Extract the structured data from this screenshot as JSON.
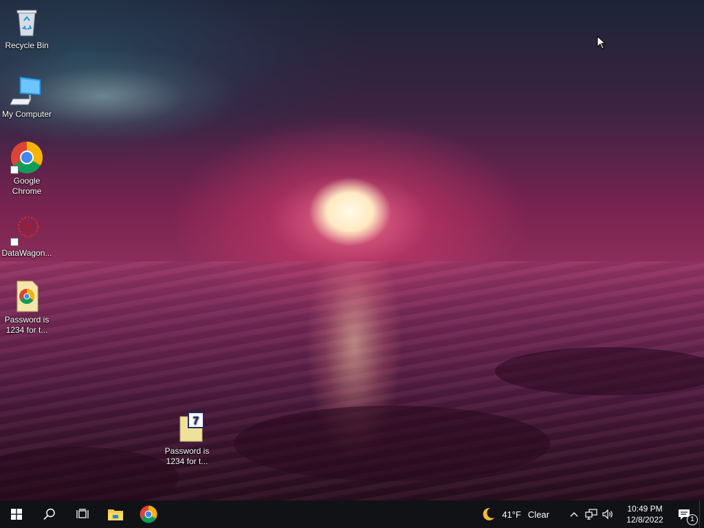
{
  "desktop": {
    "icons": [
      {
        "label": "Recycle Bin",
        "icon": "recycle-bin-icon"
      },
      {
        "label": "My Computer",
        "icon": "computer-monitor-icon"
      },
      {
        "label": "Google Chrome",
        "icon": "chrome-icon"
      },
      {
        "label": "DataWagon...",
        "icon": "datawagon-icon"
      },
      {
        "label": "Password is 1234 for t...",
        "icon": "chrome-document-icon"
      },
      {
        "label": "Password is 1234 for t...",
        "icon": "7zip-archive-icon"
      }
    ]
  },
  "taskbar": {
    "buttons": [
      {
        "name": "start",
        "icon": "windows-logo-icon"
      },
      {
        "name": "search",
        "icon": "search-icon"
      },
      {
        "name": "task-view",
        "icon": "task-view-icon"
      },
      {
        "name": "file-explorer",
        "icon": "folder-icon"
      },
      {
        "name": "chrome",
        "icon": "chrome-icon"
      }
    ],
    "accent_color": "#76b9ed"
  },
  "tray": {
    "weather": {
      "temp": "41°F",
      "condition": "Clear",
      "icon": "moon-icon"
    },
    "icons": [
      "chevron-up-icon",
      "network-icon",
      "volume-icon"
    ],
    "clock": {
      "time": "10:49 PM",
      "date": "12/8/2022"
    },
    "notifications": {
      "count": "1",
      "icon": "notification-icon"
    }
  }
}
